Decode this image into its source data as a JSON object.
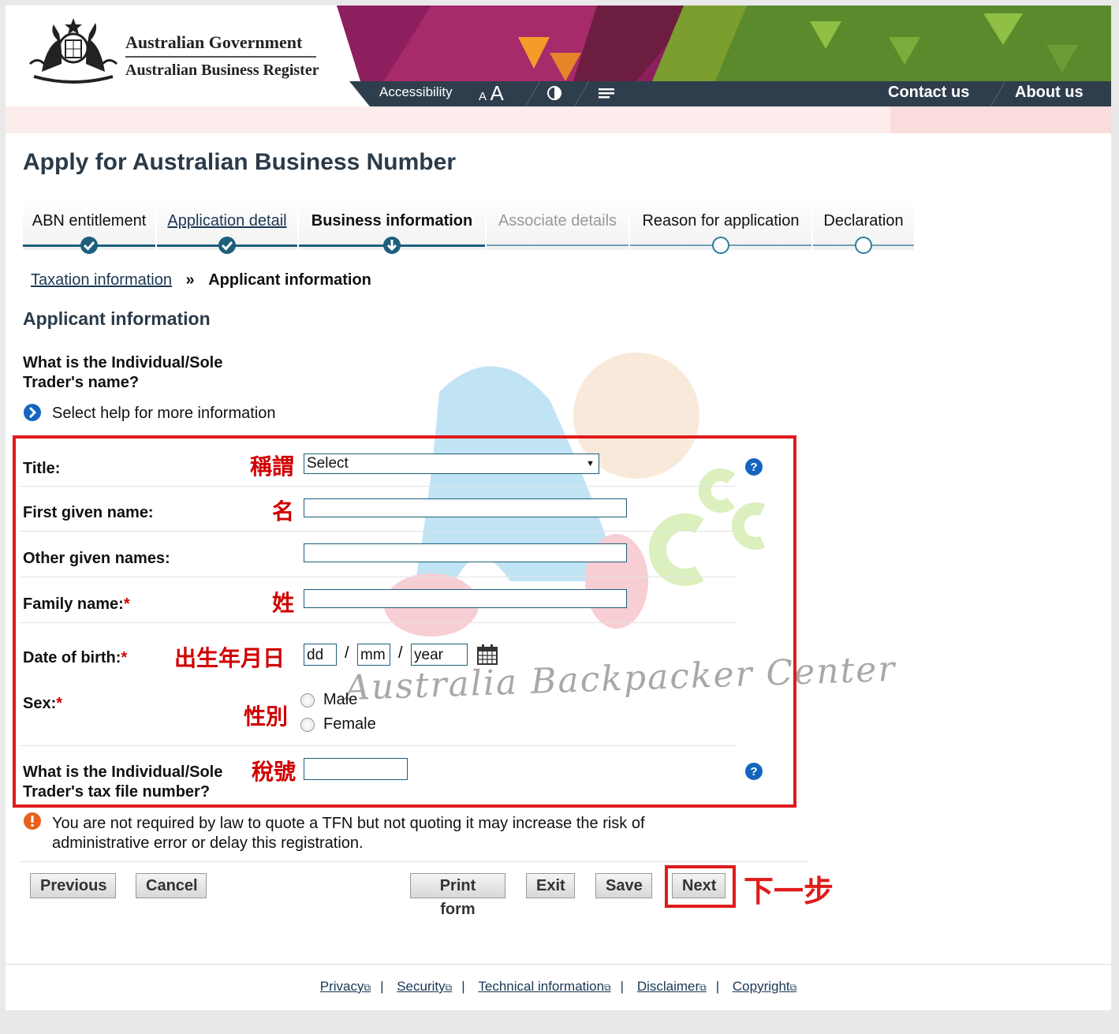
{
  "header": {
    "gov_name": "Australian Government",
    "register_name": "Australian Business Register",
    "nav": {
      "accessibility": "Accessibility",
      "text_small": "A",
      "text_large": "A",
      "contact": "Contact us",
      "about": "About us"
    }
  },
  "page_title": "Apply for Australian Business Number",
  "steps": [
    {
      "label": "ABN entitlement",
      "state": "complete"
    },
    {
      "label": "Application detail",
      "state": "complete"
    },
    {
      "label": "Business information",
      "state": "current"
    },
    {
      "label": "Associate details",
      "state": "disabled"
    },
    {
      "label": "Reason for application",
      "state": "pending"
    },
    {
      "label": "Declaration",
      "state": "pending"
    }
  ],
  "breadcrumb": {
    "link": "Taxation information",
    "separator": "»",
    "current": "Applicant information"
  },
  "section_heading": "Applicant information",
  "question_name": "What is the Individual/Sole Trader's name?",
  "help_text": "Select help for more information",
  "form": {
    "title": {
      "label": "Title:",
      "annotation": "稱謂",
      "value": "Select"
    },
    "first_name": {
      "label": "First given name:",
      "annotation": "名",
      "value": ""
    },
    "other_names": {
      "label": "Other given names:",
      "value": ""
    },
    "family_name": {
      "label": "Family name:",
      "required": "*",
      "annotation": "姓",
      "value": ""
    },
    "dob": {
      "label": "Date of birth:",
      "required": "*",
      "annotation": "出生年月日",
      "day": "dd",
      "month": "mm",
      "year": "year",
      "sep": "/"
    },
    "sex": {
      "label": "Sex:",
      "required": "*",
      "annotation": "性別",
      "options": [
        "Male",
        "Female"
      ]
    },
    "tfn": {
      "label": "What is the Individual/Sole Trader's tax file number?",
      "annotation": "稅號",
      "value": ""
    }
  },
  "notice": "You are not required by law to quote a TFN but not quoting it may increase the risk of administrative error or delay this registration.",
  "buttons": {
    "previous": "Previous",
    "cancel": "Cancel",
    "print": "Print form",
    "exit": "Exit",
    "save": "Save",
    "next": "Next",
    "next_annotation": "下一步"
  },
  "watermark": "Australia Backpacker Center",
  "footer": {
    "links": [
      "Privacy",
      "Security",
      "Technical information",
      "Disclaimer",
      "Copyright"
    ],
    "separator": "|"
  },
  "colors": {
    "nav_bar": "#2f3e4d",
    "step_bar": "#1d5f7c",
    "annotation_red": "#e01b1b",
    "link": "#1a3654",
    "help_blue": "#1565c0"
  }
}
